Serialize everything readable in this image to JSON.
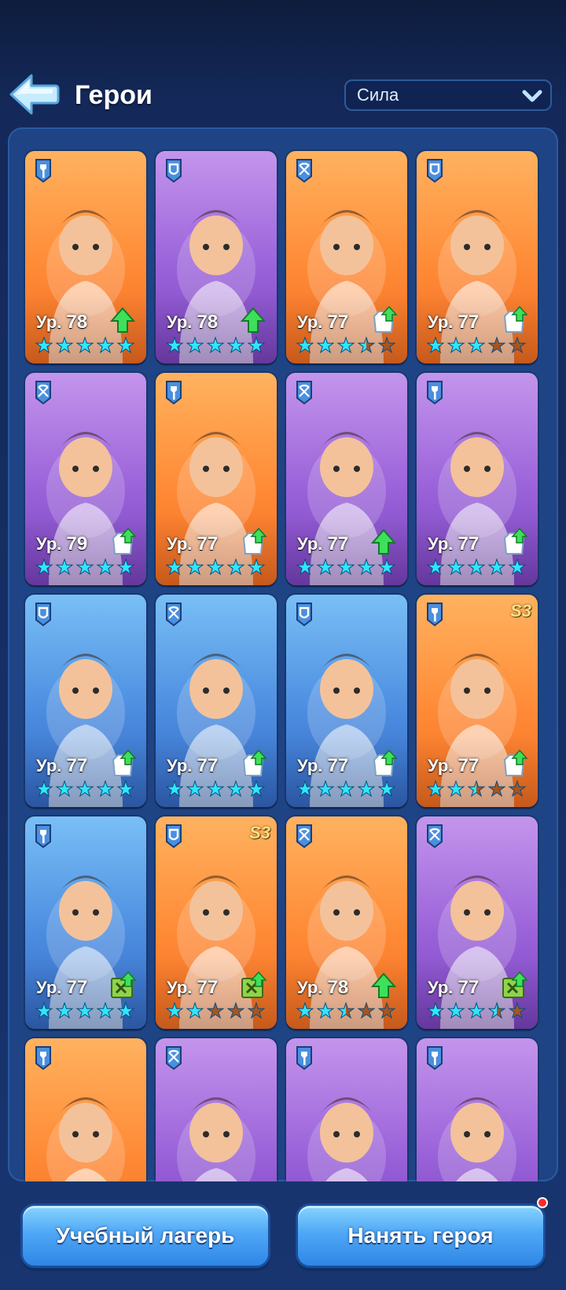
{
  "header": {
    "title": "Герои",
    "sort": {
      "selected": "Сила"
    }
  },
  "colors": {
    "orange_card": "#ff8a36",
    "purple_card": "#9a62d9",
    "blue_card": "#4c8de0",
    "star": "#2ee6ff",
    "button": "#4fa8f6"
  },
  "heroes": [
    {
      "bg": "orange",
      "role": "shovel-icon",
      "level": "78",
      "upgrade": "up-arrow-icon",
      "stars": 5,
      "season": ""
    },
    {
      "bg": "purple",
      "role": "shield-icon",
      "level": "78",
      "upgrade": "up-arrow-icon",
      "stars": 5,
      "season": ""
    },
    {
      "bg": "orange",
      "role": "crossbow-icon",
      "level": "77",
      "upgrade": "coat-upgrade-icon",
      "stars": 3.5,
      "season": ""
    },
    {
      "bg": "orange",
      "role": "shield-icon",
      "level": "77",
      "upgrade": "coat-upgrade-icon",
      "stars": 3,
      "season": ""
    },
    {
      "bg": "purple",
      "role": "crossbow-icon",
      "level": "79",
      "upgrade": "coat-upgrade-icon",
      "stars": 5,
      "season": ""
    },
    {
      "bg": "orange",
      "role": "shovel-icon",
      "level": "77",
      "upgrade": "coat-upgrade-icon",
      "stars": 5,
      "season": ""
    },
    {
      "bg": "purple",
      "role": "crossbow-icon",
      "level": "77",
      "upgrade": "up-arrow-icon",
      "stars": 5,
      "season": ""
    },
    {
      "bg": "purple",
      "role": "shovel-icon",
      "level": "77",
      "upgrade": "coat-upgrade-icon",
      "stars": 5,
      "season": ""
    },
    {
      "bg": "blue",
      "role": "shield-icon",
      "level": "77",
      "upgrade": "coat-upgrade-icon",
      "stars": 5,
      "season": ""
    },
    {
      "bg": "blue",
      "role": "crossbow-icon",
      "level": "77",
      "upgrade": "coat-upgrade-icon",
      "stars": 5,
      "season": ""
    },
    {
      "bg": "blue",
      "role": "shield-icon",
      "level": "77",
      "upgrade": "coat-upgrade-icon",
      "stars": 5,
      "season": ""
    },
    {
      "bg": "orange",
      "role": "shovel-icon",
      "level": "77",
      "upgrade": "coat-upgrade-icon",
      "stars": 2.5,
      "season": "S3"
    },
    {
      "bg": "blue",
      "role": "shovel-icon",
      "level": "77",
      "upgrade": "manual-upgrade-icon",
      "stars": 5,
      "season": ""
    },
    {
      "bg": "orange",
      "role": "shield-icon",
      "level": "77",
      "upgrade": "manual-upgrade-icon",
      "stars": 2,
      "season": "S3"
    },
    {
      "bg": "orange",
      "role": "crossbow-icon",
      "level": "78",
      "upgrade": "up-arrow-icon",
      "stars": 2.5,
      "season": ""
    },
    {
      "bg": "purple",
      "role": "crossbow-icon",
      "level": "77",
      "upgrade": "manual-upgrade-icon",
      "stars": 3.5,
      "season": ""
    },
    {
      "bg": "orange",
      "role": "shovel-icon",
      "level": "",
      "upgrade": "",
      "stars": 0,
      "season": ""
    },
    {
      "bg": "purple",
      "role": "crossbow-icon",
      "level": "",
      "upgrade": "",
      "stars": 0,
      "season": ""
    },
    {
      "bg": "purple",
      "role": "shovel-icon",
      "level": "",
      "upgrade": "",
      "stars": 0,
      "season": ""
    },
    {
      "bg": "purple",
      "role": "shovel-icon",
      "level": "",
      "upgrade": "",
      "stars": 0,
      "season": ""
    }
  ],
  "level_prefix": "Ур.",
  "buttons": {
    "training": "Учебный лагерь",
    "hire": "Нанять героя"
  }
}
